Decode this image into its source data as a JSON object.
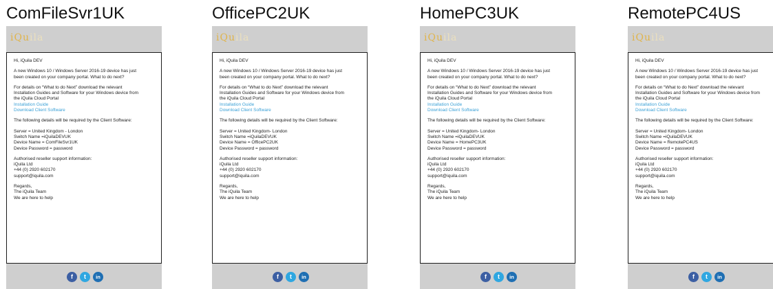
{
  "logo": {
    "main": "iQu",
    "faded": "ila"
  },
  "social": {
    "facebook": "f",
    "twitter": "t",
    "linkedin": "in"
  },
  "colors": {
    "header_bg": "#cfcfcf",
    "link": "#3aa0d6",
    "logo_gold": "#e0b44a"
  },
  "panels": [
    {
      "title": "ComFileSvr1UK",
      "greeting": "Hi, iQuila DEV",
      "intro_1": "A new Windows 10 / Windows Server 2016-19 device has just",
      "intro_2": "been created on your company portal.  What to do next?",
      "details_1": "For details on “What to do Next” download the relevant",
      "details_2": "Installation Guides and Software for your Windows device from",
      "details_3": "the iQuila Cloud Portal",
      "link_guide": "Installation Guide",
      "link_software": "Download Client Software",
      "required": "The following details will be required by the Client Software:",
      "server": "Server = United Kingdom - London",
      "switch": "Switch Name =iQuilaDEVUK",
      "device": "Device Name = ComFileSvr1UK",
      "password": "Device Password = password",
      "reseller": "Authorised reseller support information:",
      "company": "iQuila Ltd",
      "phone": "+44 (0) 2920 602170",
      "email": "support@iquila.com",
      "regards": "Regards,",
      "team": "The iQuila Team",
      "help": "We are here to help"
    },
    {
      "title": "OfficePC2UK",
      "greeting": "Hi, iQuila DEV",
      "intro_1": "A new Windows 10 / Windows Server 2016-19 device has just",
      "intro_2": "been created on your company portal.  What to do next?",
      "details_1": "For details on “What to do Next” download the relevant",
      "details_2": "Installation Guides and Software for your Windows device from",
      "details_3": "the iQuila Cloud Portal",
      "link_guide": "Installation Guide",
      "link_software": "Download Client Software",
      "required": "The following details will be required by the Client Software:",
      "server": "Server = United Kingdom- London",
      "switch": "Switch Name =iQuilaDEVUK",
      "device": "Device Name = OfficePC2UK",
      "password": "Device Password = password",
      "reseller": "Authorised reseller support information:",
      "company": "iQuila Ltd",
      "phone": "+44 (0) 2920 602170",
      "email": "support@iquila.com",
      "regards": "Regards,",
      "team": "The iQuila Team",
      "help": "We are here to help"
    },
    {
      "title": "HomePC3UK",
      "greeting": "Hi, iQuila DEV",
      "intro_1": "A new Windows 10 / Windows Server 2016-19 device has just",
      "intro_2": "been created on your company portal.  What to do next?",
      "details_1": "For details on “What to do Next” download the relevant",
      "details_2": "Installation Guides and Software for your Windows device from",
      "details_3": "the iQuila Cloud Portal",
      "link_guide": "Installation Guide",
      "link_software": "Download Client Software",
      "required": "The following details will be required by the Client Software:",
      "server": "Server = United Kingdom- London",
      "switch": "Switch Name =iQuilaDEVUK",
      "device": "Device Name = HomePC3UK",
      "password": "Device Password = password",
      "reseller": "Authorised reseller support information:",
      "company": "iQuila Ltd",
      "phone": "+44 (0) 2920 602170",
      "email": "support@iquila.com",
      "regards": "Regards,",
      "team": "The iQuila Team",
      "help": "We are here to help"
    },
    {
      "title": "RemotePC4US",
      "greeting": "Hi, iQuila DEV",
      "intro_1": "A new Windows 10 / Windows Server 2016-19 device has just",
      "intro_2": "been created on your company portal.  What to do next?",
      "details_1": "For details on “What to do Next” download the relevant",
      "details_2": "Installation Guides and Software for your Windows device from",
      "details_3": "the iQuila Cloud Portal",
      "link_guide": "Installation Guide",
      "link_software": "Download Client Software",
      "required": "The following details will be required by the Client Software:",
      "server": "Server = United Kingdom- London",
      "switch": "Switch Name =iQuilaDEVUK",
      "device": "Device Name = RemotePC4US",
      "password": "Device Password = password",
      "reseller": "Authorised reseller support information:",
      "company": "iQuila Ltd",
      "phone": "+44 (0) 2920 602170",
      "email": "support@iquila.com",
      "regards": "Regards,",
      "team": "The iQuila Team",
      "help": "We are here to help"
    }
  ]
}
